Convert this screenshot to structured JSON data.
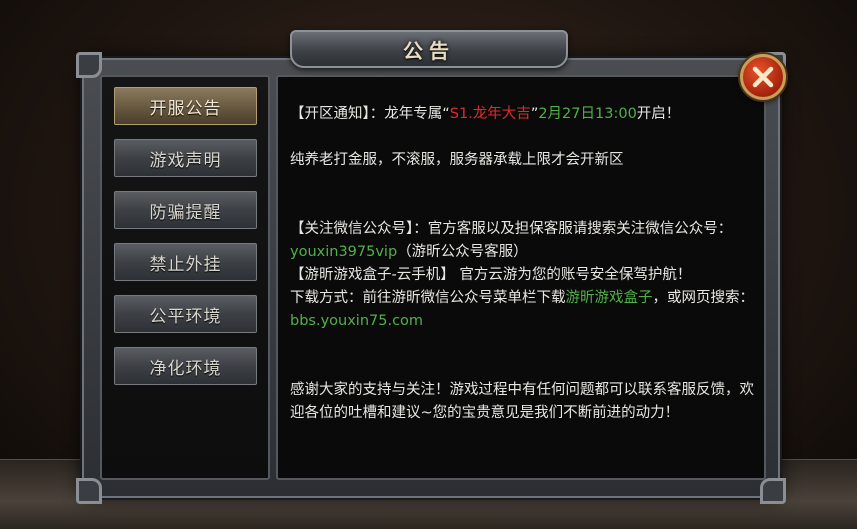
{
  "dialog": {
    "title": "公告"
  },
  "tabs": [
    {
      "label": "开服公告",
      "active": true
    },
    {
      "label": "游戏声明",
      "active": false
    },
    {
      "label": "防骗提醒",
      "active": false
    },
    {
      "label": "禁止外挂",
      "active": false
    },
    {
      "label": "公平环境",
      "active": false
    },
    {
      "label": "净化环境",
      "active": false
    }
  ],
  "content": {
    "p1_a": "【开区通知】：龙年专属“",
    "p1_red": "S1.龙年大吉",
    "p1_b": "”",
    "p1_green": "2月27日13:00",
    "p1_c": "开启！",
    "p2": "纯养老打金服，不滚服，服务器承载上限才会开新区",
    "p3_a": "【关注微信公众号】：官方客服以及担保客服请搜索关注微信公众号：",
    "p3_green": "youxin3975vip",
    "p3_b": "（游昕公众号客服）",
    "p4": "【游昕游戏盒子-云手机】 官方云游为您的账号安全保驾护航！",
    "p5_a": "下载方式：前往游昕微信公众号菜单栏下载",
    "p5_green": "游昕游戏盒子",
    "p5_b": "，或网页搜索：",
    "p5_link": "bbs.youxin75.com",
    "p6": "感谢大家的支持与关注！游戏过程中有任何问题都可以联系客服反馈，欢迎各位的吐槽和建议~您的宝贵意见是我们不断前进的动力！"
  },
  "close": {
    "icon": "close-icon"
  },
  "colors": {
    "highlight_red": "#e02a2a",
    "highlight_green": "#52b04a",
    "close_button": "#c7381a"
  }
}
